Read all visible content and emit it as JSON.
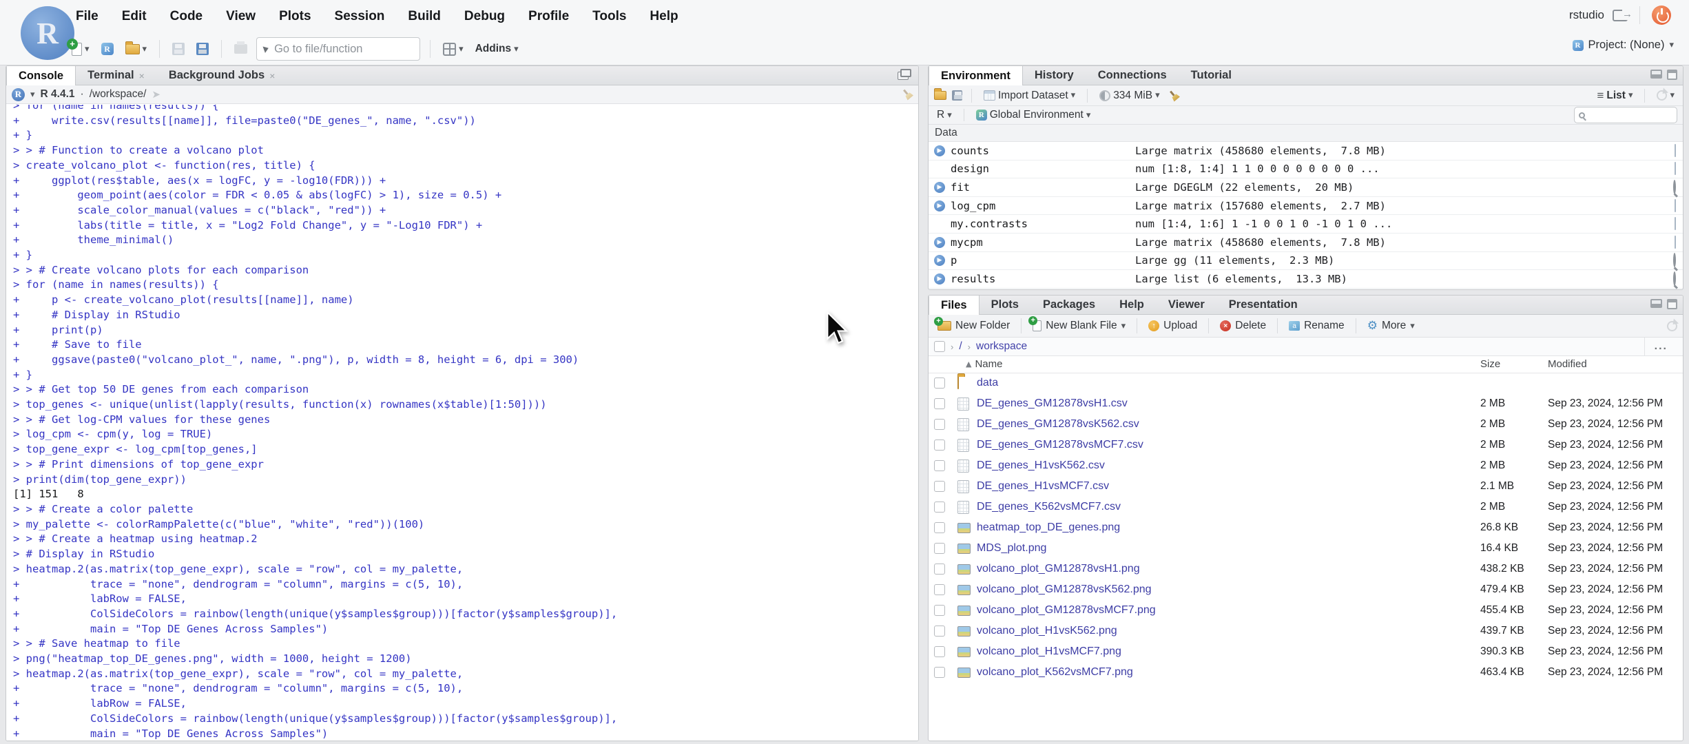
{
  "app": {
    "session_label": "rstudio",
    "project_label": "Project: (None)"
  },
  "menu_bar": {
    "items": [
      "File",
      "Edit",
      "Code",
      "View",
      "Plots",
      "Session",
      "Build",
      "Debug",
      "Profile",
      "Tools",
      "Help"
    ]
  },
  "toolbar": {
    "goto_placeholder": "Go to file/function",
    "addins_label": "Addins"
  },
  "console_panel": {
    "tabs": [
      {
        "label": "Console",
        "active": true,
        "closable": false
      },
      {
        "label": "Terminal",
        "active": false,
        "closable": true
      },
      {
        "label": "Background Jobs",
        "active": false,
        "closable": true
      }
    ],
    "header": {
      "r_version": "R 4.4.1",
      "separator": "·",
      "cwd": "/workspace/"
    },
    "lines": [
      {
        "t": "> for (name in names(results)) {",
        "k": "in"
      },
      {
        "t": "+     write.csv(results[[name]], file=paste0(\"DE_genes_\", name, \".csv\"))",
        "k": "in"
      },
      {
        "t": "+ }",
        "k": "in"
      },
      {
        "t": "> > # Function to create a volcano plot",
        "k": "in"
      },
      {
        "t": "> create_volcano_plot <- function(res, title) {",
        "k": "in"
      },
      {
        "t": "+     ggplot(res$table, aes(x = logFC, y = -log10(FDR))) +",
        "k": "in"
      },
      {
        "t": "+         geom_point(aes(color = FDR < 0.05 & abs(logFC) > 1), size = 0.5) +",
        "k": "in"
      },
      {
        "t": "+         scale_color_manual(values = c(\"black\", \"red\")) +",
        "k": "in"
      },
      {
        "t": "+         labs(title = title, x = \"Log2 Fold Change\", y = \"-Log10 FDR\") +",
        "k": "in"
      },
      {
        "t": "+         theme_minimal()",
        "k": "in"
      },
      {
        "t": "+ }",
        "k": "in"
      },
      {
        "t": "> > # Create volcano plots for each comparison",
        "k": "in"
      },
      {
        "t": "> for (name in names(results)) {",
        "k": "in"
      },
      {
        "t": "+     p <- create_volcano_plot(results[[name]], name)",
        "k": "in"
      },
      {
        "t": "+     # Display in RStudio",
        "k": "in"
      },
      {
        "t": "+     print(p)",
        "k": "in"
      },
      {
        "t": "+     # Save to file",
        "k": "in"
      },
      {
        "t": "+     ggsave(paste0(\"volcano_plot_\", name, \".png\"), p, width = 8, height = 6, dpi = 300)",
        "k": "in"
      },
      {
        "t": "+ }",
        "k": "in"
      },
      {
        "t": "> > # Get top 50 DE genes from each comparison",
        "k": "in"
      },
      {
        "t": "> top_genes <- unique(unlist(lapply(results, function(x) rownames(x$table)[1:50])))",
        "k": "in"
      },
      {
        "t": "> > # Get log-CPM values for these genes",
        "k": "in"
      },
      {
        "t": "> log_cpm <- cpm(y, log = TRUE)",
        "k": "in"
      },
      {
        "t": "> top_gene_expr <- log_cpm[top_genes,]",
        "k": "in"
      },
      {
        "t": "> > # Print dimensions of top_gene_expr",
        "k": "in"
      },
      {
        "t": "> print(dim(top_gene_expr))",
        "k": "in"
      },
      {
        "t": "[1] 151   8",
        "k": "out"
      },
      {
        "t": "> > # Create a color palette",
        "k": "in"
      },
      {
        "t": "> my_palette <- colorRampPalette(c(\"blue\", \"white\", \"red\"))(100)",
        "k": "in"
      },
      {
        "t": "> > # Create a heatmap using heatmap.2",
        "k": "in"
      },
      {
        "t": "> # Display in RStudio",
        "k": "in"
      },
      {
        "t": "> heatmap.2(as.matrix(top_gene_expr), scale = \"row\", col = my_palette,",
        "k": "in"
      },
      {
        "t": "+           trace = \"none\", dendrogram = \"column\", margins = c(5, 10),",
        "k": "in"
      },
      {
        "t": "+           labRow = FALSE,",
        "k": "in"
      },
      {
        "t": "+           ColSideColors = rainbow(length(unique(y$samples$group)))[factor(y$samples$group)],",
        "k": "in"
      },
      {
        "t": "+           main = \"Top DE Genes Across Samples\")",
        "k": "in"
      },
      {
        "t": "> > # Save heatmap to file",
        "k": "in"
      },
      {
        "t": "> png(\"heatmap_top_DE_genes.png\", width = 1000, height = 1200)",
        "k": "in"
      },
      {
        "t": "> heatmap.2(as.matrix(top_gene_expr), scale = \"row\", col = my_palette,",
        "k": "in"
      },
      {
        "t": "+           trace = \"none\", dendrogram = \"column\", margins = c(5, 10),",
        "k": "in"
      },
      {
        "t": "+           labRow = FALSE,",
        "k": "in"
      },
      {
        "t": "+           ColSideColors = rainbow(length(unique(y$samples$group)))[factor(y$samples$group)],",
        "k": "in"
      },
      {
        "t": "+           main = \"Top DE Genes Across Samples\")",
        "k": "in"
      }
    ]
  },
  "environment_panel": {
    "tabs": [
      {
        "label": "Environment",
        "active": true
      },
      {
        "label": "History",
        "active": false
      },
      {
        "label": "Connections",
        "active": false
      },
      {
        "label": "Tutorial",
        "active": false
      }
    ],
    "toolbar": {
      "import_label": "Import Dataset",
      "memory_label": "334 MiB",
      "list_label": "List"
    },
    "scope_bar": {
      "language": "R",
      "scope": "Global Environment"
    },
    "section_label": "Data",
    "objects": [
      {
        "name": "counts",
        "value": "Large matrix (458680 elements,  7.8 MB)",
        "expandable": true,
        "action": "table"
      },
      {
        "name": "design",
        "value": "num [1:8, 1:4] 1 1 0 0 0 0 0 0 0 0 ...",
        "expandable": false,
        "action": "table"
      },
      {
        "name": "fit",
        "value": "Large DGEGLM (22 elements,  20 MB)",
        "expandable": true,
        "action": "magnifier"
      },
      {
        "name": "log_cpm",
        "value": "Large matrix (157680 elements,  2.7 MB)",
        "expandable": true,
        "action": "table"
      },
      {
        "name": "my.contrasts",
        "value": "num [1:4, 1:6] 1 -1 0 0 1 0 -1 0 1 0 ...",
        "expandable": false,
        "action": "table"
      },
      {
        "name": "mycpm",
        "value": "Large matrix (458680 elements,  7.8 MB)",
        "expandable": true,
        "action": "table"
      },
      {
        "name": "p",
        "value": "Large gg (11 elements,  2.3 MB)",
        "expandable": true,
        "action": "magnifier"
      },
      {
        "name": "results",
        "value": "Large list (6 elements,  13.3 MB)",
        "expandable": true,
        "action": "magnifier"
      }
    ]
  },
  "files_panel": {
    "tabs": [
      {
        "label": "Files",
        "active": true
      },
      {
        "label": "Plots",
        "active": false
      },
      {
        "label": "Packages",
        "active": false
      },
      {
        "label": "Help",
        "active": false
      },
      {
        "label": "Viewer",
        "active": false
      },
      {
        "label": "Presentation",
        "active": false
      }
    ],
    "toolbar": [
      {
        "label": "New Folder",
        "icon": "new-folder",
        "caret": false
      },
      {
        "label": "New Blank File",
        "icon": "new-file",
        "caret": true
      },
      {
        "label": "Upload",
        "icon": "upload",
        "caret": false
      },
      {
        "label": "Delete",
        "icon": "delete",
        "caret": false
      },
      {
        "label": "Rename",
        "icon": "rename",
        "caret": false
      },
      {
        "label": "More",
        "icon": "gear",
        "caret": true
      }
    ],
    "breadcrumb": {
      "root": "/",
      "path": "workspace",
      "overflow": "..."
    },
    "columns": {
      "name": "Name",
      "size": "Size",
      "modified": "Modified"
    },
    "files": [
      {
        "name": "data",
        "type": "folder",
        "size": "",
        "modified": ""
      },
      {
        "name": "DE_genes_GM12878vsH1.csv",
        "type": "csv",
        "size": "2 MB",
        "modified": "Sep 23, 2024, 12:56 PM"
      },
      {
        "name": "DE_genes_GM12878vsK562.csv",
        "type": "csv",
        "size": "2 MB",
        "modified": "Sep 23, 2024, 12:56 PM"
      },
      {
        "name": "DE_genes_GM12878vsMCF7.csv",
        "type": "csv",
        "size": "2 MB",
        "modified": "Sep 23, 2024, 12:56 PM"
      },
      {
        "name": "DE_genes_H1vsK562.csv",
        "type": "csv",
        "size": "2 MB",
        "modified": "Sep 23, 2024, 12:56 PM"
      },
      {
        "name": "DE_genes_H1vsMCF7.csv",
        "type": "csv",
        "size": "2.1 MB",
        "modified": "Sep 23, 2024, 12:56 PM"
      },
      {
        "name": "DE_genes_K562vsMCF7.csv",
        "type": "csv",
        "size": "2 MB",
        "modified": "Sep 23, 2024, 12:56 PM"
      },
      {
        "name": "heatmap_top_DE_genes.png",
        "type": "png",
        "size": "26.8 KB",
        "modified": "Sep 23, 2024, 12:56 PM"
      },
      {
        "name": "MDS_plot.png",
        "type": "png",
        "size": "16.4 KB",
        "modified": "Sep 23, 2024, 12:56 PM"
      },
      {
        "name": "volcano_plot_GM12878vsH1.png",
        "type": "png",
        "size": "438.2 KB",
        "modified": "Sep 23, 2024, 12:56 PM"
      },
      {
        "name": "volcano_plot_GM12878vsK562.png",
        "type": "png",
        "size": "479.4 KB",
        "modified": "Sep 23, 2024, 12:56 PM"
      },
      {
        "name": "volcano_plot_GM12878vsMCF7.png",
        "type": "png",
        "size": "455.4 KB",
        "modified": "Sep 23, 2024, 12:56 PM"
      },
      {
        "name": "volcano_plot_H1vsK562.png",
        "type": "png",
        "size": "439.7 KB",
        "modified": "Sep 23, 2024, 12:56 PM"
      },
      {
        "name": "volcano_plot_H1vsMCF7.png",
        "type": "png",
        "size": "390.3 KB",
        "modified": "Sep 23, 2024, 12:56 PM"
      },
      {
        "name": "volcano_plot_K562vsMCF7.png",
        "type": "png",
        "size": "463.4 KB",
        "modified": "Sep 23, 2024, 12:56 PM"
      }
    ]
  },
  "colors": {
    "command_blue": "#3434c4",
    "link_indigo": "#3d3da5",
    "panel_border": "#c7c9cc",
    "toolbar_bg": "#f3f4f6",
    "page_bg": "#e7e8ea"
  }
}
